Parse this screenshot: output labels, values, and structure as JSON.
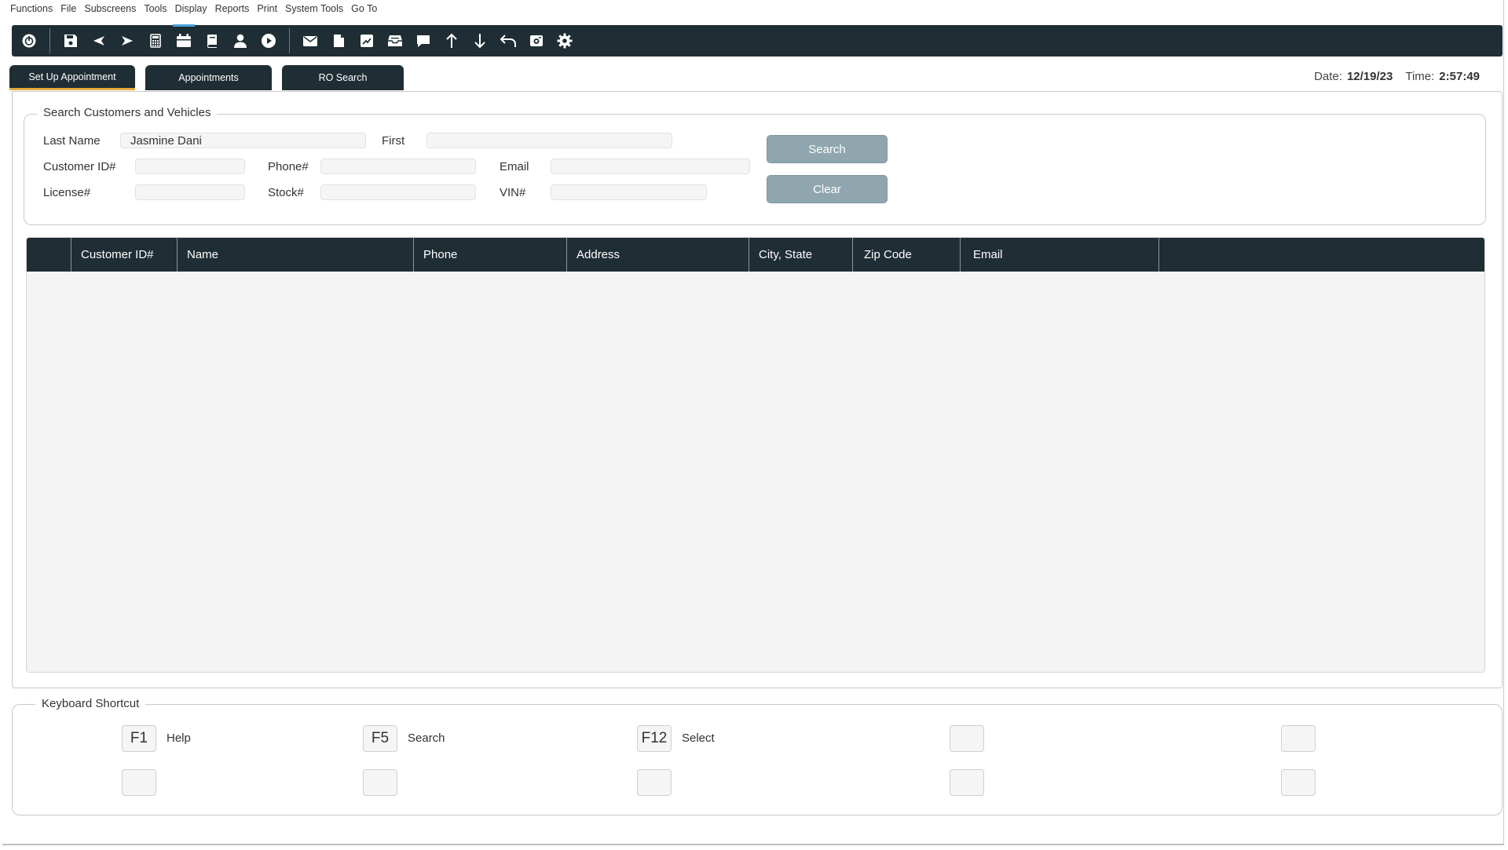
{
  "menu": [
    "Functions",
    "File",
    "Subscreens",
    "Tools",
    "Display",
    "Reports",
    "Print",
    "System Tools",
    "Go To"
  ],
  "toolbar": {
    "icons": [
      "power-icon",
      "save-icon",
      "back-icon",
      "forward-icon",
      "calculator-icon",
      "calendar-icon",
      "book-icon",
      "person-icon",
      "play-icon",
      "mail-icon",
      "document-icon",
      "chart-icon",
      "inbox-icon",
      "chat-icon",
      "arrow-up-icon",
      "arrow-down-icon",
      "undo-icon",
      "camera-icon",
      "gear-icon"
    ]
  },
  "tabs": [
    {
      "label": "Set Up Appointment",
      "active": true
    },
    {
      "label": "Appointments",
      "active": false
    },
    {
      "label": "RO Search",
      "active": false
    }
  ],
  "datetime": {
    "date_label": "Date:",
    "date": "12/19/23",
    "time_label": "Time:",
    "time": "2:57:49"
  },
  "search": {
    "title": "Search Customers and Vehicles",
    "last_name_label": "Last Name",
    "last_name_value": "Jasmine Dani",
    "first_label": "First",
    "first_value": "",
    "customer_id_label": "Customer ID#",
    "customer_id_value": "",
    "phone_label": "Phone#",
    "phone_value": "",
    "email_label": "Email",
    "email_value": "",
    "license_label": "License#",
    "license_value": "",
    "stock_label": "Stock#",
    "stock_value": "",
    "vin_label": "VIN#",
    "vin_value": "",
    "search_button": "Search",
    "clear_button": "Clear"
  },
  "grid": {
    "columns": [
      "",
      "Customer ID#",
      "Name",
      "Phone",
      "Address",
      "City, State",
      "Zip Code",
      "Email",
      ""
    ],
    "rows": []
  },
  "shortcuts": {
    "title": "Keyboard Shortcut",
    "items": [
      {
        "key": "F1",
        "label": "Help"
      },
      {
        "key": "F5",
        "label": "Search"
      },
      {
        "key": "F12",
        "label": "Select"
      },
      {
        "key": "",
        "label": ""
      },
      {
        "key": "",
        "label": ""
      },
      {
        "key": "",
        "label": ""
      },
      {
        "key": "",
        "label": ""
      },
      {
        "key": "",
        "label": ""
      },
      {
        "key": "",
        "label": ""
      },
      {
        "key": "",
        "label": ""
      }
    ]
  },
  "colors": {
    "toolbar_bg": "#1f2d34",
    "active_tab_accent": "#e2a93b",
    "button_bg": "#8fa6ae"
  }
}
